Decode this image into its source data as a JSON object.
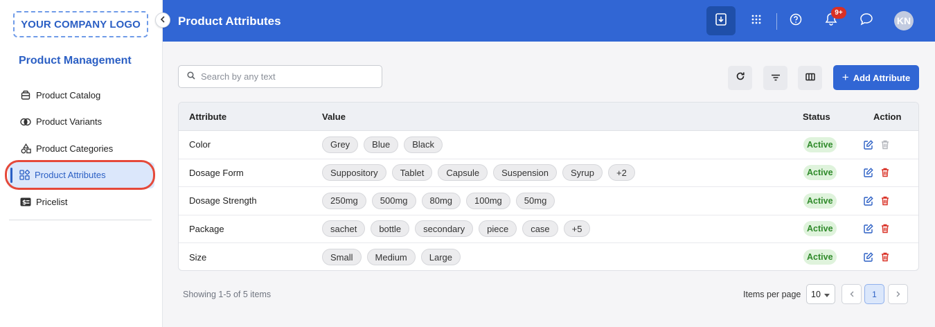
{
  "sidebar": {
    "logo": "YOUR COMPANY LOGO",
    "title": "Product Management",
    "items": [
      {
        "label": "Product Catalog",
        "icon": "box-icon"
      },
      {
        "label": "Product Variants",
        "icon": "variants-icon"
      },
      {
        "label": "Product Categories",
        "icon": "categories-icon"
      },
      {
        "label": "Product Attributes",
        "icon": "attributes-icon",
        "active": true
      },
      {
        "label": "Pricelist",
        "icon": "pricelist-icon"
      }
    ]
  },
  "header": {
    "title": "Product Attributes",
    "notification_badge": "9+",
    "avatar_initials": "KN"
  },
  "toolbar": {
    "search_placeholder": "Search by any text",
    "add_label": "Add Attribute"
  },
  "table": {
    "columns": {
      "attribute": "Attribute",
      "value": "Value",
      "status": "Status",
      "action": "Action"
    },
    "rows": [
      {
        "attribute": "Color",
        "values": [
          "Grey",
          "Blue",
          "Black"
        ],
        "more": "",
        "status": "Active",
        "delete_enabled": false
      },
      {
        "attribute": "Dosage Form",
        "values": [
          "Suppository",
          "Tablet",
          "Capsule",
          "Suspension",
          "Syrup"
        ],
        "more": "+2",
        "status": "Active",
        "delete_enabled": true
      },
      {
        "attribute": "Dosage Strength",
        "values": [
          "250mg",
          "500mg",
          "80mg",
          "100mg",
          "50mg"
        ],
        "more": "",
        "status": "Active",
        "delete_enabled": true
      },
      {
        "attribute": "Package",
        "values": [
          "sachet",
          "bottle",
          "secondary",
          "piece",
          "case"
        ],
        "more": "+5",
        "status": "Active",
        "delete_enabled": true
      },
      {
        "attribute": "Size",
        "values": [
          "Small",
          "Medium",
          "Large"
        ],
        "more": "",
        "status": "Active",
        "delete_enabled": true
      }
    ]
  },
  "footer": {
    "showing": "Showing 1-5 of 5 items",
    "items_per_page_label": "Items per page",
    "items_per_page_value": "10",
    "current_page": "1"
  },
  "colors": {
    "primary": "#3166d4",
    "active_status_bg": "#dff3dc",
    "active_status_text": "#2f8a2a",
    "delete": "#d93025",
    "edit": "#2b5fc4",
    "highlight_ring": "#e5493a"
  }
}
